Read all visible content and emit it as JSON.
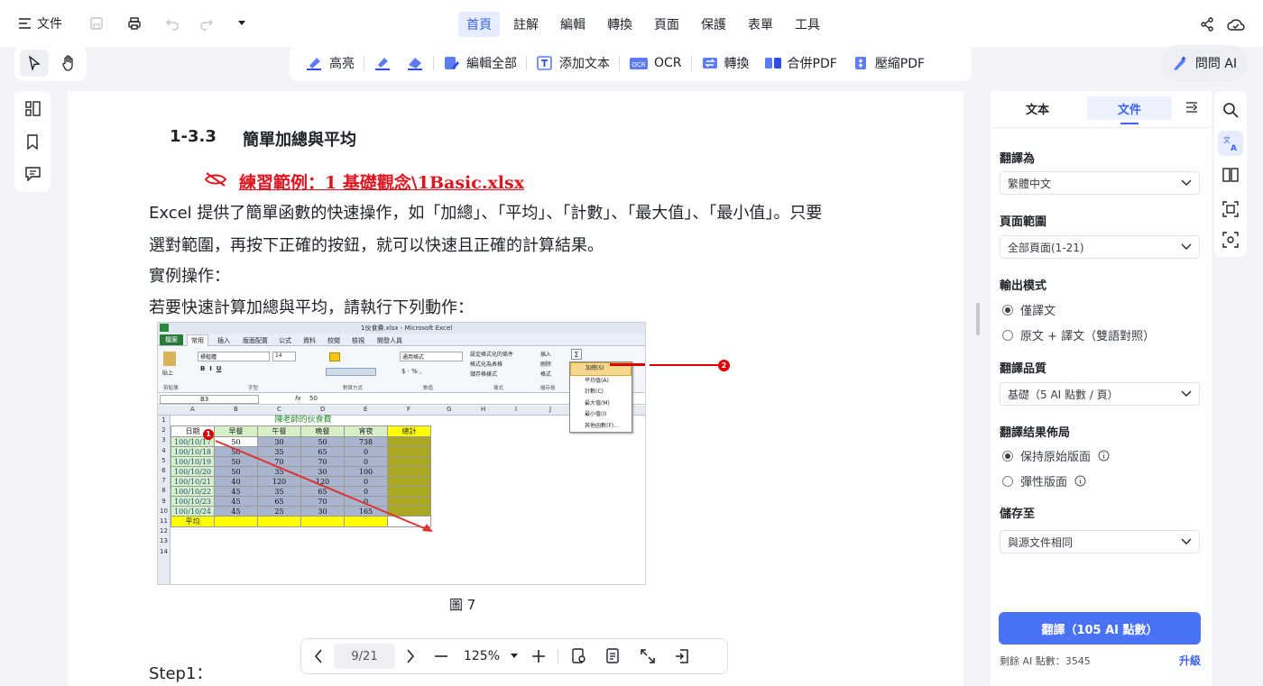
{
  "app": {
    "file_menu": "文件"
  },
  "nav_tabs": [
    "首頁",
    "註解",
    "編輯",
    "轉換",
    "頁面",
    "保護",
    "表單",
    "工具"
  ],
  "tools": {
    "highlight": "高亮",
    "edit_all": "編輯全部",
    "add_text": "添加文本",
    "ocr": "OCR",
    "convert": "轉換",
    "merge_pdf": "合併PDF",
    "compress_pdf": "壓縮PDF"
  },
  "ask_ai": "問問 AI",
  "document": {
    "section_number": "1-3.3",
    "section_title": "簡單加總與平均",
    "exercise_link": "練習範例：1 基礎觀念\\1Basic.xlsx",
    "para1_line1": "Excel 提供了簡單函數的快速操作，如「加總」、「平均」、「計數」、「最大值」、「最小值」。只要",
    "para1_line2": "選對範圍，再按下正確的按鈕，就可以快速且正確的計算結果。",
    "para2": "實例操作：",
    "para3": "若要快速計算加總與平均，請執行下列動作：",
    "figure_caption": "圖 7",
    "step": "Step1："
  },
  "excel": {
    "window_title": "1伙食費.xlsx - Microsoft Excel",
    "ribbon_tabs": [
      "檔案",
      "常用",
      "插入",
      "版面配置",
      "公式",
      "資料",
      "校閱",
      "檢視",
      "開發人員"
    ],
    "font_name": "標楷體",
    "font_size": "14",
    "number_format": "通用格式",
    "name_box": "B3",
    "formula_value": "50",
    "group_labels": [
      "剪貼簿",
      "字型",
      "對齊方式",
      "數值",
      "樣式",
      "儲存格"
    ],
    "style_items": [
      "設定格式化的條件",
      "格式化為表格",
      "儲存格樣式"
    ],
    "cell_items": [
      "插入",
      "刪除",
      "格式"
    ],
    "paste_label": "貼上",
    "autosum_menu": [
      "加總(S)",
      "平均值(A)",
      "計數(C)",
      "最大值(M)",
      "最小值(I)",
      "其他函數(F)..."
    ],
    "col_headers": [
      "A",
      "B",
      "C",
      "D",
      "E",
      "F",
      "G",
      "H",
      "I",
      "J"
    ],
    "sheet_title": "陳老師的伙食費",
    "headers": [
      "日期",
      "早餐",
      "午餐",
      "晚餐",
      "宵夜",
      "總計"
    ],
    "rows": [
      [
        "100/10/17",
        "50",
        "30",
        "50",
        "738"
      ],
      [
        "100/10/18",
        "50",
        "35",
        "65",
        "0"
      ],
      [
        "100/10/19",
        "50",
        "70",
        "70",
        "0"
      ],
      [
        "100/10/20",
        "50",
        "35",
        "30",
        "100"
      ],
      [
        "100/10/21",
        "40",
        "120",
        "120",
        "0"
      ],
      [
        "100/10/22",
        "45",
        "35",
        "65",
        "0"
      ],
      [
        "100/10/23",
        "45",
        "65",
        "70",
        "0"
      ],
      [
        "100/10/24",
        "45",
        "25",
        "30",
        "165"
      ]
    ],
    "average_label": "平均",
    "marker1": "1",
    "marker2": "2"
  },
  "right_panel": {
    "tab_text": "文本",
    "tab_document": "文件",
    "translate_to_label": "翻譯為",
    "translate_to_value": "繁體中文",
    "page_range_label": "頁面範圍",
    "page_range_value": "全部頁面(1-21)",
    "output_mode_label": "輸出模式",
    "output_opt1": "僅譯文",
    "output_opt2": "原文 + 譯文（雙語對照）",
    "quality_label": "翻譯品質",
    "quality_value": "基礎（5 AI 點數 / 頁）",
    "layout_label": "翻譯结果佈局",
    "layout_opt1": "保持原始版面",
    "layout_opt2": "彈性版面",
    "save_to_label": "儲存至",
    "save_to_value": "與源文件相同",
    "translate_button": "翻譯（105 AI 點數）",
    "remaining_label": "剩餘 AI 點數：3545",
    "upgrade_link": "升級"
  },
  "bottom_bar": {
    "page_indicator": "9/21",
    "zoom": "125%"
  },
  "colors": {
    "accent": "#3b62f5",
    "button": "#4a72f7",
    "link_red": "#e0141e"
  }
}
